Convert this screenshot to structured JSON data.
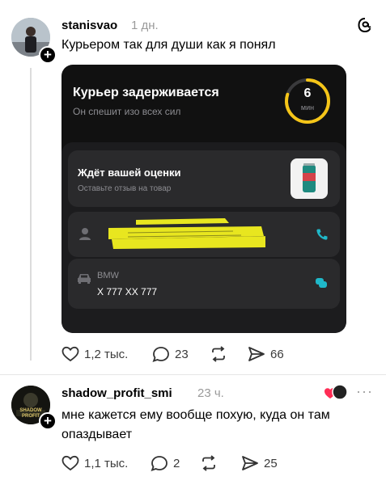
{
  "post": {
    "username": "stanisvao",
    "time": "1 дн.",
    "text": "Курьером так для души как я понял",
    "threads_icon": "threads-logo-icon",
    "image": {
      "title": "Курьер задерживается",
      "subtitle": "Он спешит изо всех сил",
      "timer_value": "6",
      "timer_unit": "мин",
      "timer_progress": 0.8,
      "accent": "#f5c518",
      "rating_title": "Ждёт вашей оценки",
      "rating_subtitle": "Оставьте отзыв на товар",
      "car_model": "BMW",
      "car_plate": "Х 777 ХХ 777",
      "call_color": "#1fb8c9"
    },
    "actions": {
      "likes": "1,2 тыс.",
      "comments": "23",
      "shares": "66"
    }
  },
  "reply": {
    "username": "shadow_profit_smi",
    "time": "23 ч.",
    "text_line1": "мне кажется ему вообще похую, куда он там",
    "text_line2": "опаздывает",
    "avatar_text": "SHADOW PROFIT",
    "more": "···",
    "actions": {
      "likes": "1,1 тыс.",
      "comments": "2",
      "shares": "25"
    }
  }
}
